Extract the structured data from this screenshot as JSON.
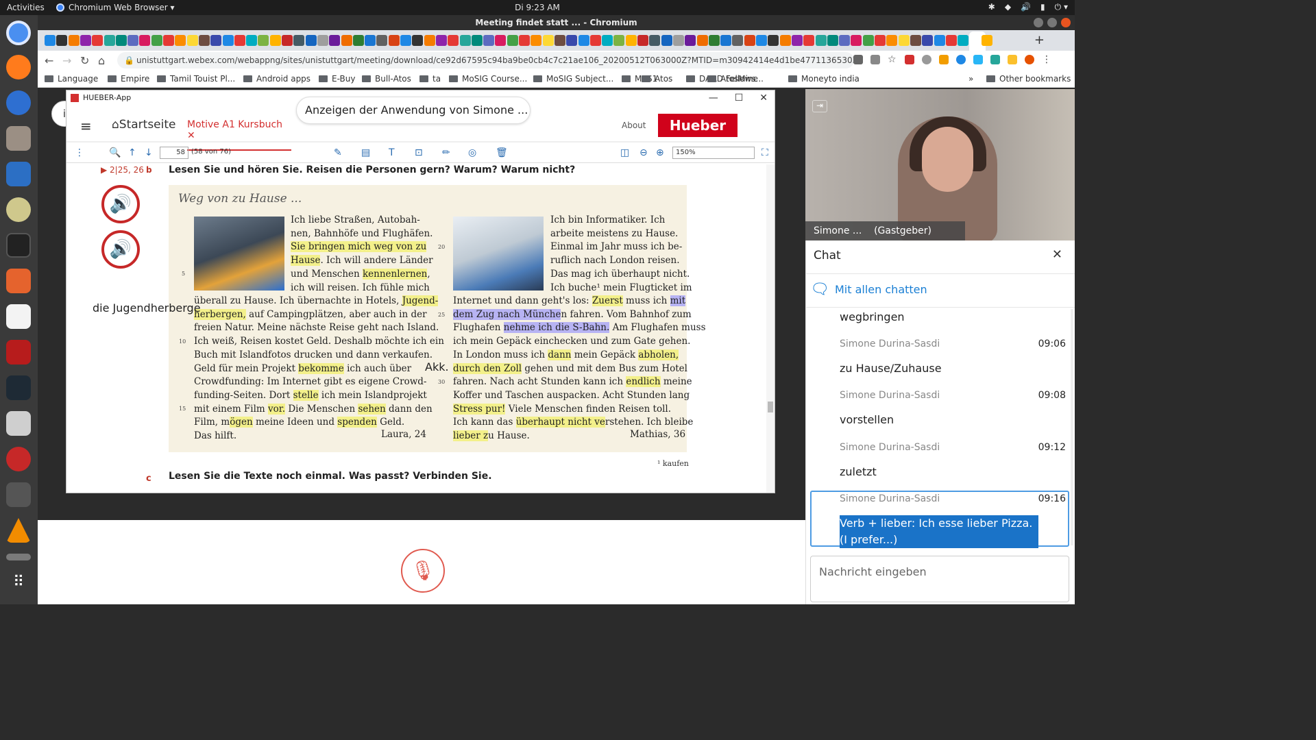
{
  "topbar": {
    "activities": "Activities",
    "app": "Chromium Web Browser ▾",
    "clock": "Di  9:23 AM",
    "tray": [
      "✱",
      "◆",
      "🔊",
      "▮",
      "⏻ ▾"
    ]
  },
  "window": {
    "title": "Meeting findet statt ... - Chromium"
  },
  "toolbar": {
    "url": "unistuttgart.webex.com/webappng/sites/unistuttgart/meeting/download/ce92d67595c94ba9be0cb4c7c21ae106_20200512T063000Z?MTID=m30942414e4d1be477113653036162165&launchApp..."
  },
  "bookmarks": {
    "items": [
      "Language",
      "Empire",
      "Tamil Touist Pl...",
      "Android apps",
      "E-Buy",
      "Bull-Atos",
      "ta",
      "MoSIG Course...",
      "MoSIG Subject...",
      "M2S1",
      "Atos",
      "DAAD Fellows...",
      "AtosMine",
      "Moneyto india"
    ],
    "more": "»",
    "other": "Other bookmarks"
  },
  "hueber": {
    "app_title": "HUEBER-App",
    "start": "Startseite",
    "tab": "Motive A1 Kursbuch",
    "about": "About",
    "logo": "Hueber",
    "page": "58",
    "page_of": "(58 von 76)",
    "zoom": "150%",
    "share_banner": "Anzeigen der Anwendung von Simone ...",
    "info": "i"
  },
  "book": {
    "audio_ref": "▶ 2|25, 26",
    "task_b_letter": "b",
    "task_b": "Lesen Sie und hören Sie. Reisen die Personen gern? Warum? Warum nicht?",
    "box_title": "Weg von zu Hause ...",
    "note_jh": "die Jugendherberge",
    "note_akk": "Akk.",
    "left_name": "Laura, 24",
    "right_name": "Mathias, 36",
    "footnote": "¹ kaufen",
    "task_c_letter": "c",
    "task_c": "Lesen Sie die Texte noch einmal. Was passt? Verbinden Sie.",
    "line_numbers_left": [
      "5",
      "10",
      "15"
    ],
    "line_numbers_right": [
      "20",
      "25",
      "30"
    ]
  },
  "video": {
    "name": "Simone ...    (Gastgeber)"
  },
  "chat": {
    "title": "Chat",
    "scope": "Mit allen chatten",
    "messages": [
      {
        "sender": "",
        "time": "",
        "body": "wegbringen"
      },
      {
        "sender": "Simone Durina-Sasdi",
        "time": "09:06",
        "body": "zu Hause/Zuhause"
      },
      {
        "sender": "Simone Durina-Sasdi",
        "time": "09:08",
        "body": "vorstellen"
      },
      {
        "sender": "Simone Durina-Sasdi",
        "time": "09:12",
        "body": "zuletzt"
      },
      {
        "sender": "Simone Durina-Sasdi",
        "time": "09:16",
        "body": "Verb + lieber: Ich esse lieber Pizza. (I prefer...)"
      }
    ],
    "placeholder": "Nachricht eingeben"
  },
  "colors": {
    "accent": "#d32f2f",
    "chat_blue": "#1a7fd4",
    "highlight_yellow": "#f3f08a",
    "highlight_blue": "#b7b3f3"
  }
}
